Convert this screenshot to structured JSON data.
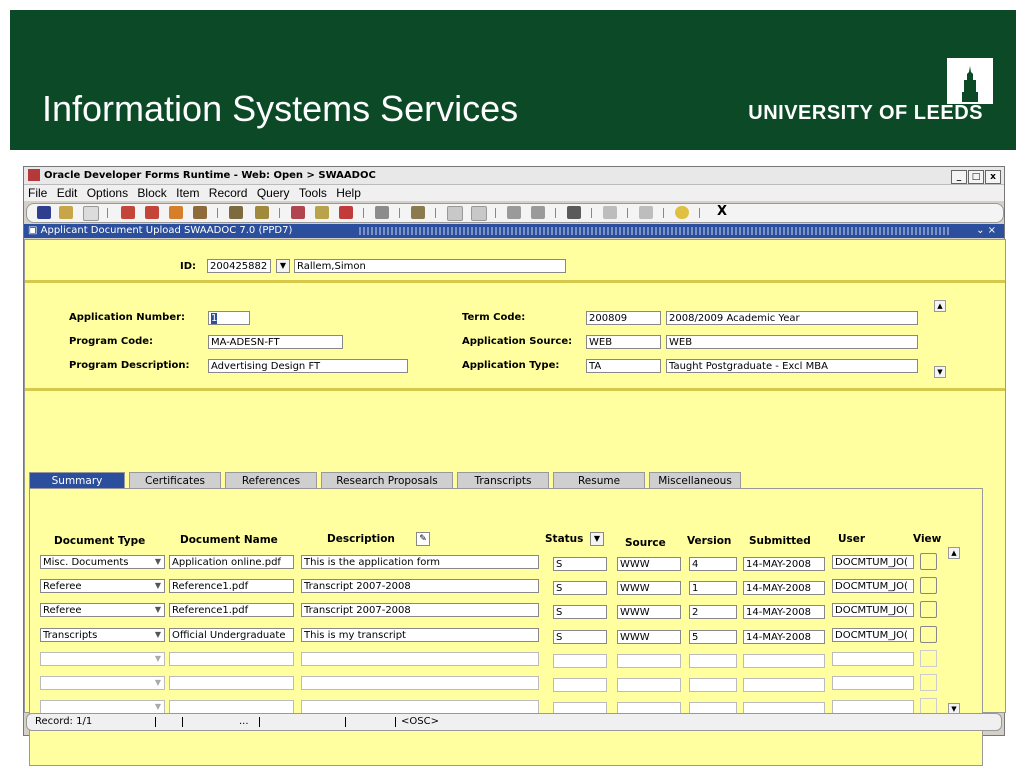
{
  "banner": {
    "title": "Information Systems Services",
    "university": "UNIVERSITY OF LEEDS"
  },
  "window": {
    "title": "Oracle Developer Forms Runtime - Web: Open > SWAADOC",
    "controls": [
      "_",
      "□",
      "x"
    ],
    "menu": [
      "File",
      "Edit",
      "Options",
      "Block",
      "Item",
      "Record",
      "Query",
      "Tools",
      "Help"
    ],
    "toolbar_close": "X"
  },
  "form": {
    "title": "Applicant Document Upload  SWAADOC  7.0  (PPD7)",
    "title_controls": "⌄ ×",
    "id_label": "ID:",
    "id_value": "200425882",
    "id_name": "Rallem,Simon",
    "application_number_label": "Application Number:",
    "application_number": "1",
    "program_code_label": "Program Code:",
    "program_code": "MA-ADESN-FT",
    "program_description_label": "Program Description:",
    "program_description": "Advertising Design FT",
    "term_code_label": "Term Code:",
    "term_code": "200809",
    "term_desc": "2008/2009 Academic Year",
    "application_source_label": "Application Source:",
    "application_source": "WEB",
    "application_source_desc": "WEB",
    "application_type_label": "Application Type:",
    "application_type": "TA",
    "application_type_desc": "Taught Postgraduate - Excl MBA"
  },
  "tabs": [
    "Summary",
    "Certificates",
    "References",
    "Research Proposals",
    "Transcripts",
    "Resume",
    "Miscellaneous"
  ],
  "table": {
    "headers": {
      "doc_type": "Document Type",
      "doc_name": "Document Name",
      "description": "Description",
      "status": "Status",
      "source": "Source",
      "version": "Version",
      "submitted": "Submitted",
      "user": "User",
      "view": "View"
    },
    "rows": [
      {
        "doc_type": "Misc. Documents",
        "doc_name": "Application online.pdf",
        "description": "This is the application form",
        "status": "S",
        "source": "WWW",
        "version": "4",
        "submitted": "14-MAY-2008",
        "user": "DOCMTUM_JO("
      },
      {
        "doc_type": "Referee",
        "doc_name": "Reference1.pdf",
        "description": "Transcript 2007-2008",
        "status": "S",
        "source": "WWW",
        "version": "1",
        "submitted": "14-MAY-2008",
        "user": "DOCMTUM_JO("
      },
      {
        "doc_type": "Referee",
        "doc_name": "Reference1.pdf",
        "description": "Transcript 2007-2008",
        "status": "S",
        "source": "WWW",
        "version": "2",
        "submitted": "14-MAY-2008",
        "user": "DOCMTUM_JO("
      },
      {
        "doc_type": "Transcripts",
        "doc_name": "Official Undergraduate",
        "description": "This is my transcript",
        "status": "S",
        "source": "WWW",
        "version": "5",
        "submitted": "14-MAY-2008",
        "user": "DOCMTUM_JO("
      }
    ]
  },
  "status_bar": {
    "record": "Record: 1/1",
    "dots": "...",
    "osc": "<OSC>"
  }
}
